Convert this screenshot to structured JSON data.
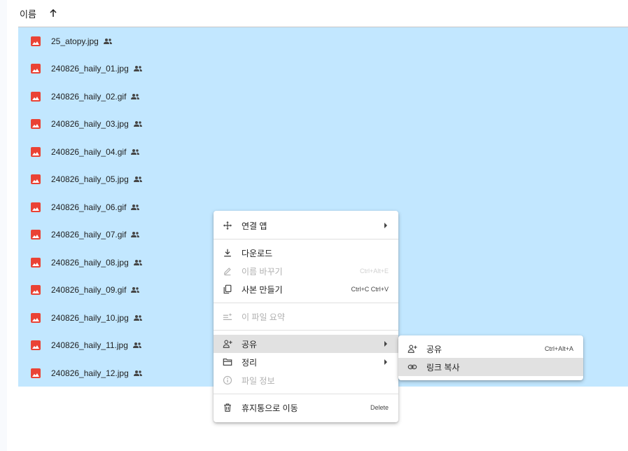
{
  "header": {
    "name_label": "이름",
    "sort_icon": "arrow-up-icon"
  },
  "files": [
    {
      "name": "25_atopy.jpg"
    },
    {
      "name": "240826_haily_01.jpg"
    },
    {
      "name": "240826_haily_02.gif"
    },
    {
      "name": "240826_haily_03.jpg"
    },
    {
      "name": "240826_haily_04.gif"
    },
    {
      "name": "240826_haily_05.jpg"
    },
    {
      "name": "240826_haily_06.gif"
    },
    {
      "name": "240826_haily_07.gif"
    },
    {
      "name": "240826_haily_08.jpg"
    },
    {
      "name": "240826_haily_09.gif"
    },
    {
      "name": "240826_haily_10.jpg"
    },
    {
      "name": "240826_haily_11.jpg"
    },
    {
      "name": "240826_haily_12.jpg"
    }
  ],
  "context_menu": {
    "open_with": "연결 앱",
    "download": "다운로드",
    "rename": "이름 바꾸기",
    "rename_shortcut": "Ctrl+Alt+E",
    "make_copy": "사본 만들기",
    "make_copy_shortcut": "Ctrl+C Ctrl+V",
    "summarize": "이 파일 요약",
    "share": "공유",
    "organize": "정리",
    "file_info": "파일 정보",
    "move_to_trash": "휴지통으로 이동",
    "trash_shortcut": "Delete"
  },
  "share_submenu": {
    "share": "공유",
    "share_shortcut": "Ctrl+Alt+A",
    "copy_link": "링크 복사"
  },
  "colors": {
    "selection": "#c2e7ff",
    "image_icon": "#ea4335",
    "menu_highlight": "#e1e1e1"
  }
}
